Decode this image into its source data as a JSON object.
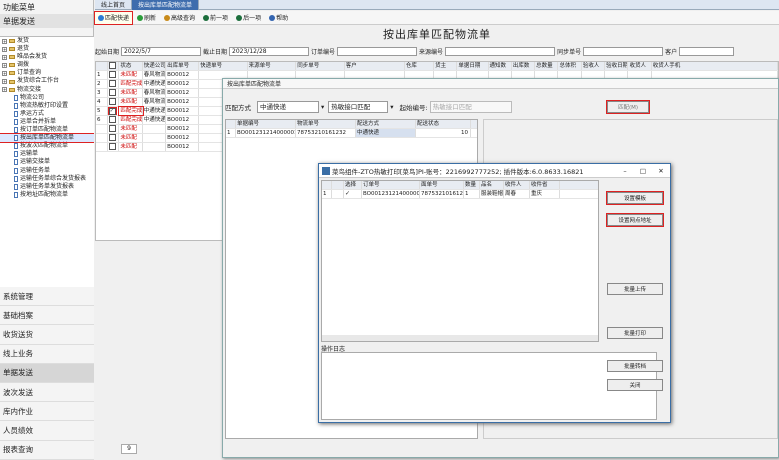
{
  "sidebar": {
    "title": "功能菜单",
    "top": "单据发送",
    "tree": [
      {
        "t": "发货",
        "lv": 0,
        "k": "pm"
      },
      {
        "t": "退货",
        "lv": 0,
        "k": "pm"
      },
      {
        "t": "唯品会发货",
        "lv": 0,
        "k": "pm"
      },
      {
        "t": "调拨",
        "lv": 0,
        "k": "pm"
      },
      {
        "t": "订单查询",
        "lv": 0,
        "k": "pm"
      },
      {
        "t": "发货综合工作台",
        "lv": 0,
        "k": "pm"
      },
      {
        "t": "物流交接",
        "lv": 0,
        "k": "pm"
      },
      {
        "t": "物流公司",
        "lv": 1,
        "k": "di"
      },
      {
        "t": "物流热敏打印设置",
        "lv": 1,
        "k": "di"
      },
      {
        "t": "承运方式",
        "lv": 1,
        "k": "di"
      },
      {
        "t": "运单合并拆单",
        "lv": 1,
        "k": "di"
      },
      {
        "t": "按订单匹配物流单",
        "lv": 1,
        "k": "di"
      },
      {
        "t": "按出库单匹配物流单",
        "lv": 1,
        "k": "di",
        "sel": true
      },
      {
        "t": "按波次匹配物流单",
        "lv": 1,
        "k": "di"
      },
      {
        "t": "运输单",
        "lv": 1,
        "k": "di"
      },
      {
        "t": "运输交接单",
        "lv": 1,
        "k": "di"
      },
      {
        "t": "运输任务单",
        "lv": 1,
        "k": "di"
      },
      {
        "t": "运输任务单综合发货报表",
        "lv": 1,
        "k": "di"
      },
      {
        "t": "运输任务单发货报表",
        "lv": 1,
        "k": "di"
      },
      {
        "t": "按地址匹配物流单",
        "lv": 1,
        "k": "di"
      }
    ],
    "modules": [
      "系统管理",
      "基础档案",
      "收货送货",
      "线上业务",
      "单据发送",
      "波次发送",
      "库内作业",
      "人员绩效",
      "报表查询"
    ],
    "active_module": "单据发送"
  },
  "tabs": [
    "线上首页",
    "按出库单匹配物流单"
  ],
  "toolbar": [
    "匹配快递",
    "刷新",
    "高级查询",
    "前一项",
    "后一项",
    "帮助"
  ],
  "title": "按出库单匹配物流单",
  "filter": {
    "start_label": "起始日期",
    "start": "2022/5/7",
    "end_label": "截止日期",
    "end": "2023/12/28",
    "order_label": "订单编号",
    "src_label": "来源编号",
    "sync_label": "同步单号",
    "cust_label": "客户"
  },
  "grid": {
    "headers": [
      "",
      "",
      "状态",
      "快递公司",
      "出库单号",
      "快递单号",
      "来源单号",
      "同步单号",
      "客户",
      "仓库",
      "货主",
      "单据日期",
      "通知数",
      "出库数",
      "总数量",
      "总体积",
      "验收人",
      "验收日期",
      "收货人",
      "收货人手机"
    ],
    "rows": [
      {
        "n": "1",
        "st": "未匹配",
        "co": "春风物流",
        "no": "BO0012"
      },
      {
        "n": "2",
        "st": "匹配完成",
        "co": "中通快递",
        "no": "BO0012"
      },
      {
        "n": "3",
        "st": "未匹配",
        "co": "春风物流",
        "no": "BO0012"
      },
      {
        "n": "4",
        "st": "未匹配",
        "co": "春风物流",
        "no": "BO0012"
      },
      {
        "n": "5",
        "st": "匹配完成",
        "co": "中通快递",
        "no": "BO0012",
        "chk": true
      },
      {
        "n": "6",
        "st": "匹配完成",
        "co": "中通快递",
        "no": "BO0012"
      },
      {
        "n": "",
        "st": "未匹配",
        "co": "",
        "no": "BO0012"
      },
      {
        "n": "",
        "st": "未匹配",
        "co": "",
        "no": "BO0012"
      },
      {
        "n": "",
        "st": "未匹配",
        "co": "",
        "no": "BO0012"
      }
    ],
    "page": "9"
  },
  "dlg1": {
    "title": "按出库单匹配物流单",
    "mode_label": "匹配方式",
    "mode": "中通快递",
    "iface": "热敏接口匹配",
    "start_label": "起始编号:",
    "start_ph": "热敏接口匹配",
    "match_btn": "匹配(M)",
    "headers": [
      "",
      "单据编号",
      "物流单号",
      "配送方式",
      "配送状态"
    ],
    "row": {
      "n": "1",
      "doc": "BO001231214000001",
      "track": "78753210161232",
      "ship": "中通快递",
      "status": "10"
    }
  },
  "dlg2": {
    "title": "菜鸟组件-ZTO热敏打印[菜鸟]PI-账号：2216992777252; 插件版本:6.0.8633.16821",
    "headers": [
      "",
      "",
      "选择",
      "订单号",
      "面单号",
      "数量",
      "品名",
      "收件人",
      "收件省"
    ],
    "row": {
      "n": "1",
      "order": "BO001231214000001",
      "waybill": "78753210161232",
      "qty": "1",
      "name": "服装鞋帽",
      "rcv": "周春",
      "prov": "重庆"
    },
    "log_label": "操作日志",
    "buttons": [
      "设置模板",
      "设置网点地址",
      "批量上传",
      "批量打印",
      "批量转档",
      "关闭"
    ],
    "win": [
      "–",
      "□",
      "✕"
    ]
  }
}
